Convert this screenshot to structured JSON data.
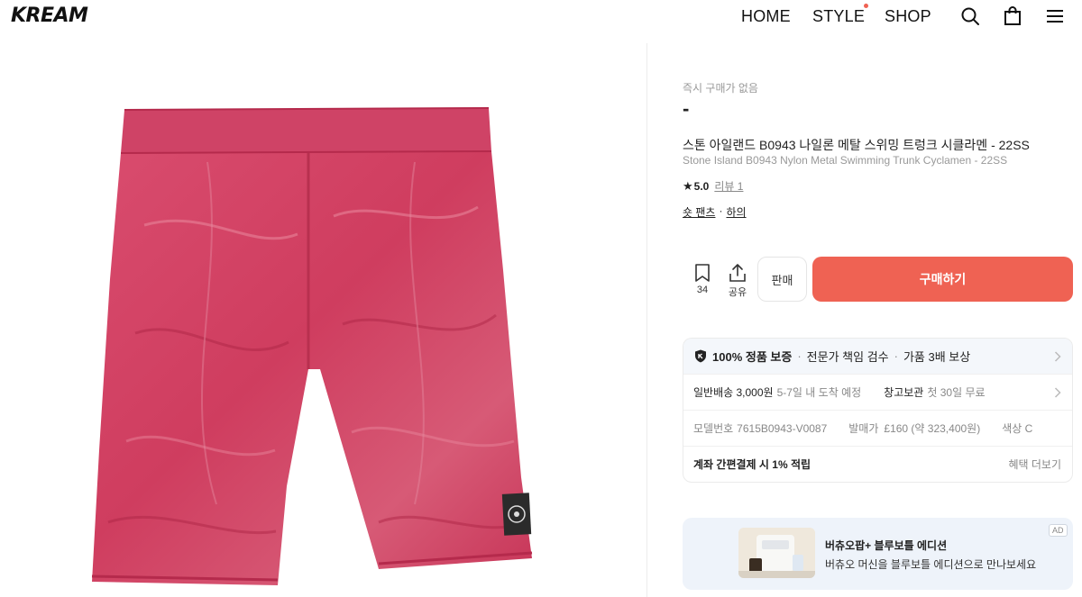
{
  "header": {
    "logo": "KREAM",
    "nav": [
      "HOME",
      "STYLE",
      "SHOP"
    ],
    "icons": [
      "search-icon",
      "shopping-bag-icon",
      "menu-icon"
    ]
  },
  "product": {
    "price_label": "즉시 구매가 없음",
    "price": "-",
    "name_ko": "스톤 아일랜드 B0943 나일론 메탈 스위밍 트렁크 시클라멘 - 22SS",
    "name_en": "Stone Island B0943 Nylon Metal Swimming Trunk Cyclamen - 22SS",
    "rating": "5.0",
    "review_label": "리뷰 1",
    "categories": [
      "숏 팬츠",
      "하의"
    ],
    "category_sep": "·",
    "image": "pink-nylon-metal-swim-shorts"
  },
  "actions": {
    "save_count": "34",
    "share_label": "공유",
    "sell_label": "판매",
    "buy_label": "구매하기"
  },
  "info": {
    "guarantee": {
      "title": "100% 정품 보증",
      "item2": "전문가 책임 검수",
      "item3": "가품 3배 보상",
      "sep": "·"
    },
    "shipping": {
      "label": "일반배송 3,000원",
      "eta": "5-7일 내 도착 예정",
      "storage_label": "창고보관",
      "storage_desc": "첫 30일 무료"
    },
    "details": {
      "model_label": "모델번호",
      "model_value": "7615B0943-V0087",
      "release_label": "발매가",
      "release_value": "£160 (약 323,400원)",
      "color_label": "색상 C"
    },
    "benefit": {
      "text": "계좌 간편결제 시 1% 적립",
      "more": "혜택 더보기"
    }
  },
  "ad": {
    "title": "버츄오팝+ 블루보틀 에디션",
    "subtitle": "버츄오 머신을 블루보틀 에디션으로 만나보세요",
    "badge": "AD"
  },
  "colors": {
    "accent": "#ef6253",
    "product": "#d9496a"
  }
}
